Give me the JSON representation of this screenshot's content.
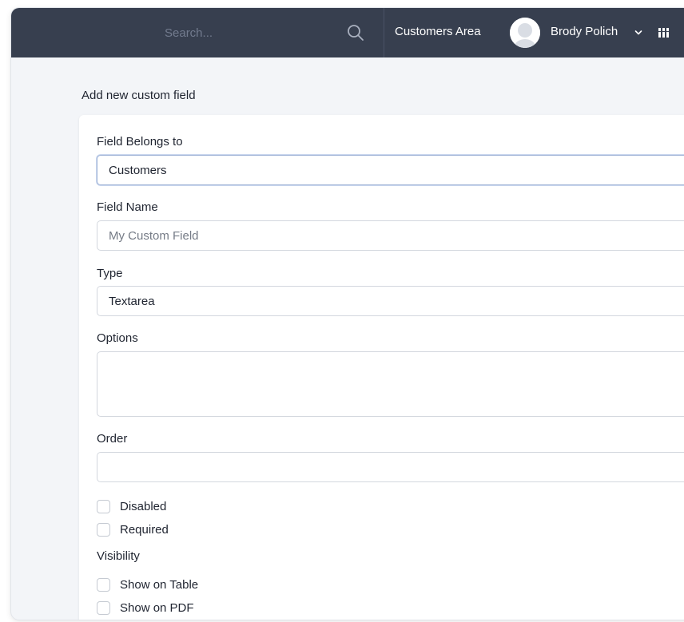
{
  "header": {
    "search_placeholder": "Search...",
    "area_link": "Customers Area",
    "user_name": "Brody Polich",
    "colors": {
      "bar_bg": "#373f4f",
      "text": "#ffffff"
    }
  },
  "page": {
    "title": "Add new custom field"
  },
  "form": {
    "belongs_to_label": "Field Belongs to",
    "belongs_to_value": "Customers",
    "name_label": "Field Name",
    "name_placeholder": "My Custom Field",
    "type_label": "Type",
    "type_value": "Textarea",
    "options_label": "Options",
    "options_value": "",
    "order_label": "Order",
    "order_value": "",
    "disabled_label": "Disabled",
    "disabled_checked": false,
    "required_label": "Required",
    "required_checked": false,
    "visibility_label": "Visibility",
    "show_table_label": "Show on Table",
    "show_table_checked": false,
    "show_pdf_label": "Show on PDF",
    "show_pdf_checked": false
  },
  "icons": {
    "search": "search-icon",
    "chevron": "chevron-down-icon",
    "grid": "grid-icon",
    "avatar": "user-avatar"
  }
}
